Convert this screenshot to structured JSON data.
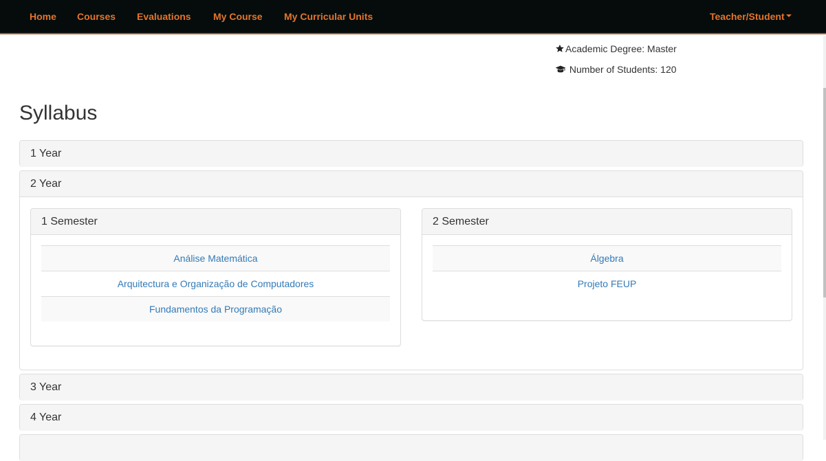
{
  "navbar": {
    "items": [
      "Home",
      "Courses",
      "Evaluations",
      "My Course",
      "My Curricular Units"
    ],
    "user_menu": "Teacher/Student",
    "accent_color": "#e5742c",
    "background_color": "#050c0b"
  },
  "info": {
    "degree_icon": "star-icon",
    "degree": "Academic Degree: Master",
    "students_icon": "graduation-cap-icon",
    "students": "Number of Students: 120"
  },
  "syllabus": {
    "title": "Syllabus",
    "years": [
      {
        "label": "1 Year",
        "expanded": false
      },
      {
        "label": "2 Year",
        "expanded": true,
        "semesters": [
          {
            "label": "1 Semester",
            "units": [
              "Análise Matemática",
              "Arquitectura e Organização de Computadores",
              "Fundamentos da Programação"
            ]
          },
          {
            "label": "2 Semester",
            "units": [
              "Álgebra",
              "Projeto FEUP"
            ]
          }
        ]
      },
      {
        "label": "3 Year",
        "expanded": false
      },
      {
        "label": "4 Year",
        "expanded": false
      },
      {
        "label": "",
        "expanded": false
      }
    ]
  },
  "colors": {
    "link": "#337ab7",
    "panel_heading_bg": "#f5f5f5",
    "border": "#dddddd"
  }
}
